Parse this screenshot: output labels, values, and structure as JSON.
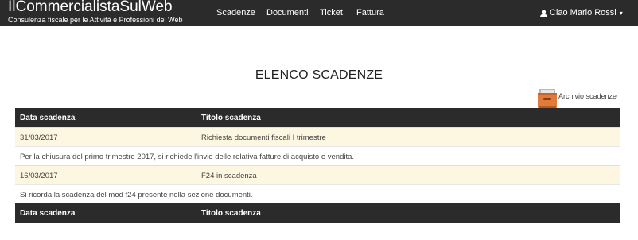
{
  "brand": {
    "title": "IlCommercialistaSulWeb",
    "subtitle": "Consulenza fiscale per le Attività e Professioni del Web"
  },
  "nav": {
    "items": [
      {
        "label": "Scadenze"
      },
      {
        "label": "Documenti"
      },
      {
        "label": "Ticket"
      },
      {
        "label": "Fattura"
      }
    ],
    "user_label": "Ciao Mario Rossi",
    "user_icon": "user-icon",
    "caret_icon": "caret-down-icon"
  },
  "page": {
    "title": "ELENCO SCADENZE",
    "archive_label": "Archivio scadenze",
    "archive_icon": "archive-box-icon"
  },
  "table": {
    "columns": [
      "Data scadenza",
      "Titolo scadenza"
    ],
    "rows": [
      {
        "date": "31/03/2017",
        "title": "Richiesta documenti fiscali I trimestre",
        "description": "Per la chiusura del primo trimestre 2017, si richiede l'invio delle relativa fatture di acquisto e vendita."
      },
      {
        "date": "16/03/2017",
        "title": "F24 in scadenza",
        "description": "Si ricorda la scadenza del mod f24 presente nella sezione documenti."
      }
    ],
    "footer_columns": [
      "Data scadenza",
      "Titolo scadenza"
    ]
  },
  "colors": {
    "navbar": "#2b2b2b",
    "row_highlight": "#fdf6e0",
    "archive_icon": "#e07b39"
  }
}
